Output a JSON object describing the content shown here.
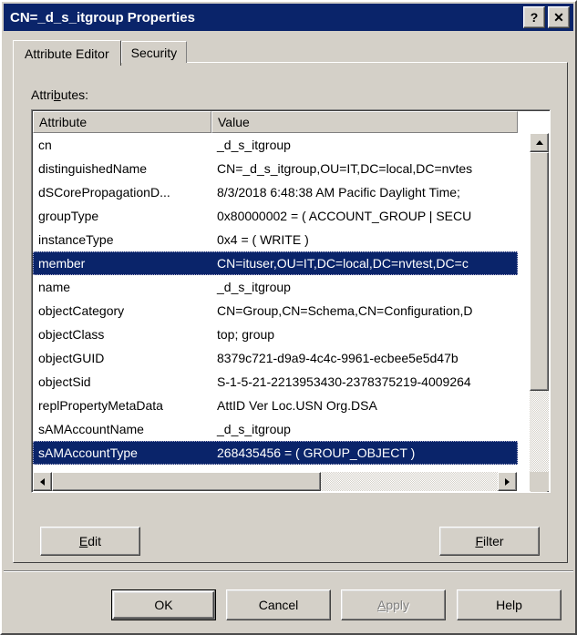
{
  "window": {
    "title": "CN=_d_s_itgroup Properties",
    "help_button": "?",
    "close_button": "✕"
  },
  "tabs": [
    {
      "label": "Attribute Editor",
      "active": true
    },
    {
      "label": "Security",
      "active": false
    }
  ],
  "attributes_label": "Attributes:",
  "list": {
    "columns": [
      "Attribute",
      "Value"
    ],
    "rows": [
      {
        "attribute": "cn",
        "value": "_d_s_itgroup",
        "selected": false
      },
      {
        "attribute": "distinguishedName",
        "value": "CN=_d_s_itgroup,OU=IT,DC=local,DC=nvtes",
        "selected": false
      },
      {
        "attribute": "dSCorePropagationD...",
        "value": "8/3/2018 6:48:38 AM Pacific Daylight Time;",
        "selected": false
      },
      {
        "attribute": "groupType",
        "value": "0x80000002 = ( ACCOUNT_GROUP | SECU",
        "selected": false
      },
      {
        "attribute": "instanceType",
        "value": "0x4 = ( WRITE )",
        "selected": false
      },
      {
        "attribute": "member",
        "value": "CN=ituser,OU=IT,DC=local,DC=nvtest,DC=c",
        "selected": true
      },
      {
        "attribute": "name",
        "value": "_d_s_itgroup",
        "selected": false
      },
      {
        "attribute": "objectCategory",
        "value": "CN=Group,CN=Schema,CN=Configuration,D",
        "selected": false
      },
      {
        "attribute": "objectClass",
        "value": "top; group",
        "selected": false
      },
      {
        "attribute": "objectGUID",
        "value": "8379c721-d9a9-4c4c-9961-ecbee5e5d47b",
        "selected": false
      },
      {
        "attribute": "objectSid",
        "value": "S-1-5-21-2213953430-2378375219-4009264",
        "selected": false
      },
      {
        "attribute": "replPropertyMetaData",
        "value": "AttID Ver   Loc.USN              Org.DSA",
        "selected": false
      },
      {
        "attribute": "sAMAccountName",
        "value": "_d_s_itgroup",
        "selected": false
      },
      {
        "attribute": "sAMAccountType",
        "value": "268435456 = ( GROUP_OBJECT )",
        "selected": true
      }
    ]
  },
  "buttons": {
    "edit": "Edit",
    "edit_accel": "E",
    "filter": "Filter",
    "filter_accel": "F",
    "ok": "OK",
    "cancel": "Cancel",
    "apply": "Apply",
    "apply_accel": "A",
    "help": "Help"
  },
  "colors": {
    "titlebar": "#0a246a",
    "selection": "#0a246a",
    "face": "#d4d0c8",
    "listbg": "#ffffff"
  }
}
